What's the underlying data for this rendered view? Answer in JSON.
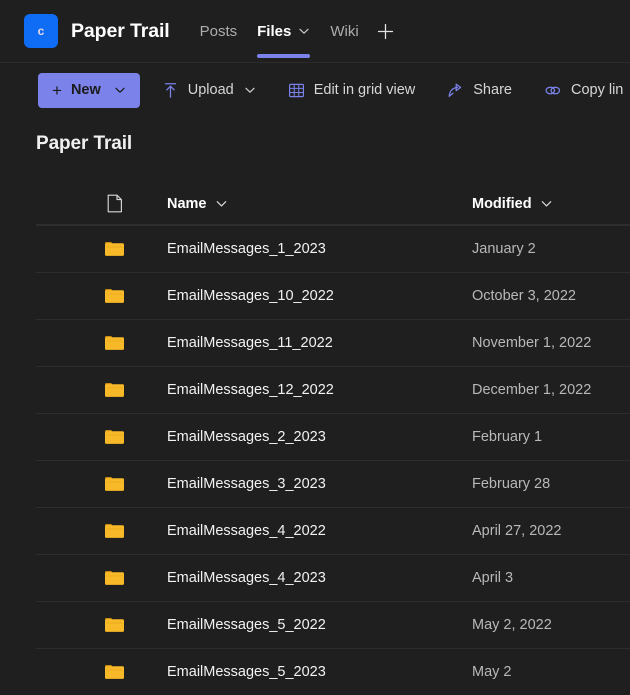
{
  "header": {
    "logo_glyph": "c",
    "logo_color": "#0f6cf5",
    "site_title": "Paper Trail",
    "tabs": [
      {
        "label": "Posts",
        "active": false,
        "has_caret": false
      },
      {
        "label": "Files",
        "active": true,
        "has_caret": true
      },
      {
        "label": "Wiki",
        "active": false,
        "has_caret": false
      }
    ],
    "add_tab_label": "+",
    "accent_color": "#7b83eb"
  },
  "toolbar": {
    "new_label": "New",
    "new_plus": "+",
    "items": [
      {
        "label": "Upload",
        "icon": "upload-icon",
        "has_caret": true
      },
      {
        "label": "Edit in grid view",
        "icon": "grid-icon",
        "has_caret": false
      },
      {
        "label": "Share",
        "icon": "share-icon",
        "has_caret": false
      },
      {
        "label": "Copy lin",
        "icon": "link-icon",
        "has_caret": false
      }
    ]
  },
  "main": {
    "page_title": "Paper Trail",
    "columns": {
      "icon": "document-icon",
      "name": "Name",
      "modified": "Modified"
    },
    "rows": [
      {
        "icon": "folder-icon",
        "name": "EmailMessages_1_2023",
        "modified": "January 2"
      },
      {
        "icon": "folder-icon",
        "name": "EmailMessages_10_2022",
        "modified": "October 3, 2022"
      },
      {
        "icon": "folder-icon",
        "name": "EmailMessages_11_2022",
        "modified": "November 1, 2022"
      },
      {
        "icon": "folder-icon",
        "name": "EmailMessages_12_2022",
        "modified": "December 1, 2022"
      },
      {
        "icon": "folder-icon",
        "name": "EmailMessages_2_2023",
        "modified": "February 1"
      },
      {
        "icon": "folder-icon",
        "name": "EmailMessages_3_2023",
        "modified": "February 28"
      },
      {
        "icon": "folder-icon",
        "name": "EmailMessages_4_2022",
        "modified": "April 27, 2022"
      },
      {
        "icon": "folder-icon",
        "name": "EmailMessages_4_2023",
        "modified": "April 3"
      },
      {
        "icon": "folder-icon",
        "name": "EmailMessages_5_2022",
        "modified": "May 2, 2022"
      },
      {
        "icon": "folder-icon",
        "name": "EmailMessages_5_2023",
        "modified": "May 2"
      }
    ]
  },
  "colors": {
    "background": "#1f1f1f",
    "accent": "#7b83eb",
    "folder": "#f5b62c",
    "logo": "#0f6cf5"
  }
}
